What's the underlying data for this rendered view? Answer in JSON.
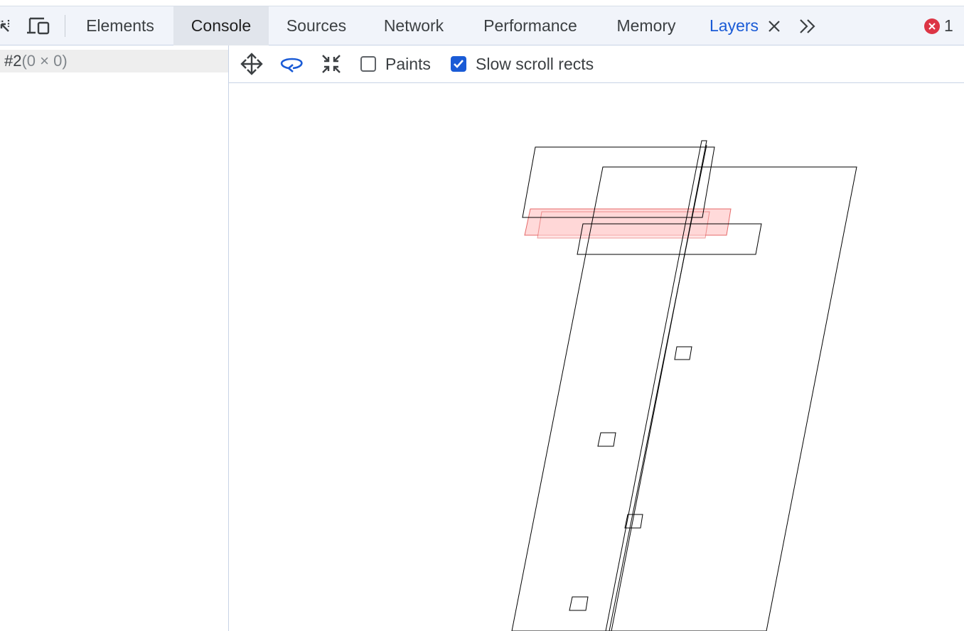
{
  "tabs": [
    {
      "label": "Elements"
    },
    {
      "label": "Console"
    },
    {
      "label": "Sources"
    },
    {
      "label": "Network"
    },
    {
      "label": "Performance"
    },
    {
      "label": "Memory"
    },
    {
      "label": "Layers"
    }
  ],
  "active_tab": "Layers",
  "hovered_tab": "Console",
  "icons": {
    "inspect": "inspect-element-icon",
    "device": "device-toolbar-icon",
    "close": "close-icon",
    "more": "more-tabs-icon",
    "error": "error-icon",
    "pan": "pan-mode-icon",
    "rotate": "rotate-mode-icon",
    "reset": "reset-transform-icon"
  },
  "error_count": "1",
  "layer_tree": {
    "items": [
      {
        "id": "#2",
        "size": "(0 × 0)"
      }
    ]
  },
  "toolbar": {
    "paints": {
      "label": "Paints",
      "checked": false
    },
    "slow_scroll_rects": {
      "label": "Slow scroll rects",
      "checked": true
    }
  },
  "colors": {
    "accent": "#1a5bd6",
    "error": "#dc3545",
    "slow_scroll_fill": "#ffd6d6",
    "slow_scroll_stroke": "#e25a5a"
  }
}
